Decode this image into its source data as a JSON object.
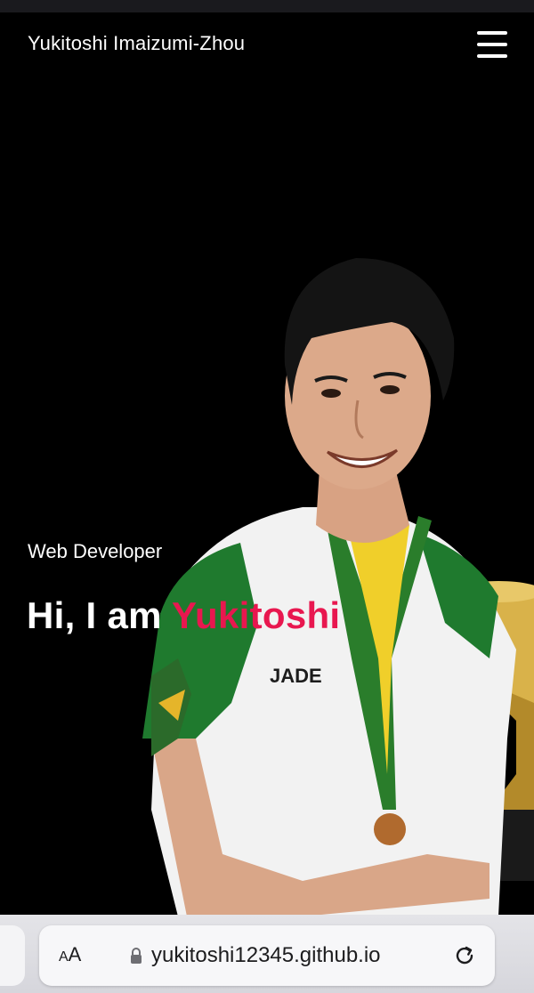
{
  "header": {
    "site_title": "Yukitoshi Imaizumi-Zhou",
    "menu_icon": "hamburger-menu-icon"
  },
  "hero": {
    "subtitle": "Web Developer",
    "heading_prefix": "Hi, I am ",
    "heading_name": "Yukitoshi",
    "accent_color": "#e8174f",
    "background_color": "#000000",
    "portrait_shirt_text": "JADE"
  },
  "browser": {
    "text_size_label_small": "A",
    "text_size_label_large": "A",
    "url": "yukitoshi12345.github.io",
    "lock_icon": "lock-icon",
    "reload_icon": "reload-icon"
  }
}
